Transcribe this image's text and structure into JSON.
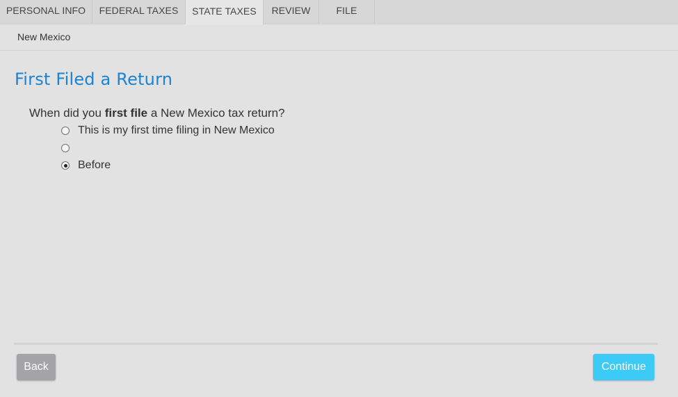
{
  "tabs": [
    {
      "label": "PERSONAL INFO",
      "active": false
    },
    {
      "label": "FEDERAL TAXES",
      "active": false
    },
    {
      "label": "STATE TAXES",
      "active": true
    },
    {
      "label": "REVIEW",
      "active": false
    },
    {
      "label": "FILE",
      "active": false
    }
  ],
  "subnav": {
    "label": "New Mexico"
  },
  "page": {
    "title": "First Filed a Return"
  },
  "question": {
    "prefix": "When did you ",
    "emphasis": "first file",
    "suffix": " a New Mexico tax return?"
  },
  "options": [
    {
      "label": "This is my first time filing in New Mexico",
      "selected": false
    },
    {
      "label": "",
      "selected": false
    },
    {
      "label": "Before",
      "selected": true
    }
  ],
  "footer": {
    "back_label": "Back",
    "continue_label": "Continue"
  },
  "colors": {
    "title": "#1b83d3",
    "continue_button": "#3ccbf7",
    "back_button": "#a4a4a6"
  }
}
